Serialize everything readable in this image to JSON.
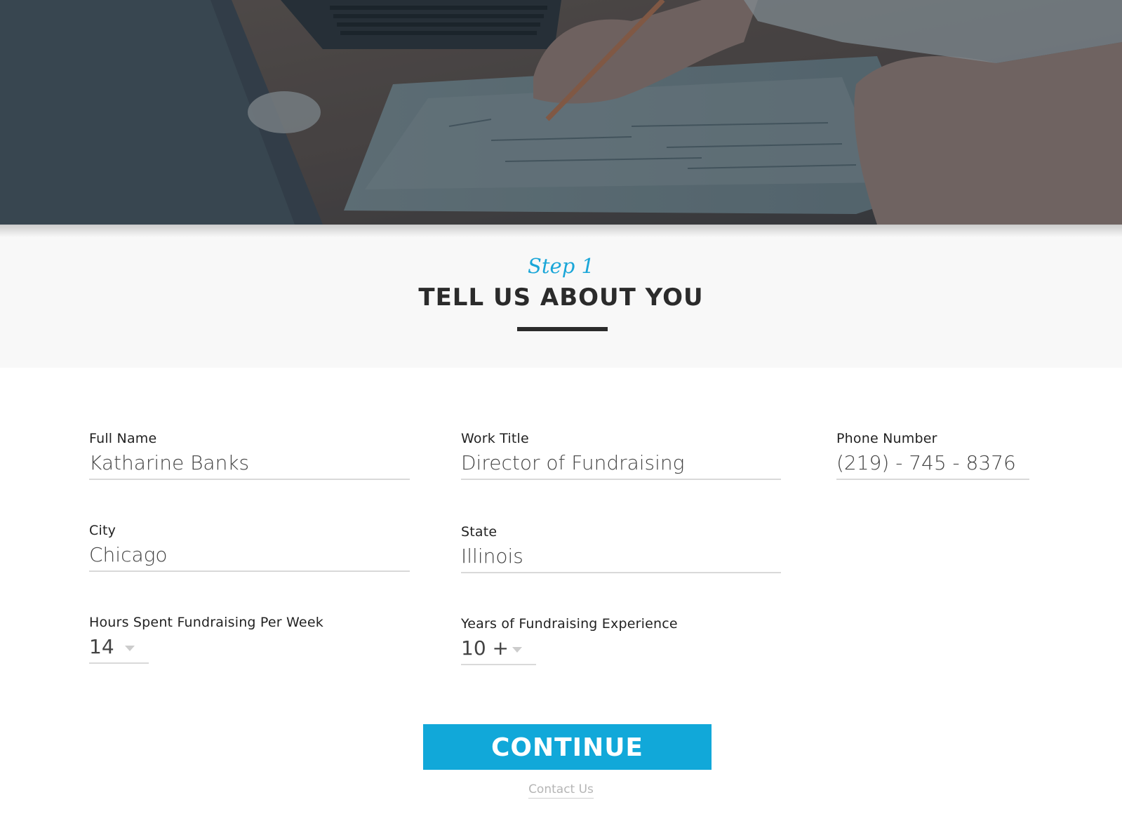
{
  "step": {
    "label": "Step 1",
    "title": "TELL US ABOUT YOU"
  },
  "form": {
    "full_name": {
      "label": "Full Name",
      "value": "Katharine Banks"
    },
    "work_title": {
      "label": "Work Title",
      "value": "Director of Fundraising"
    },
    "phone": {
      "label": "Phone Number",
      "value": "(219) - 745 - 8376"
    },
    "city": {
      "label": "City",
      "value": "Chicago"
    },
    "state": {
      "label": "State",
      "value": "Illinois"
    },
    "hours": {
      "label": "Hours Spent Fundraising Per Week",
      "selected": "14"
    },
    "years": {
      "label": "Years of Fundraising Experience",
      "selected": "10 +"
    }
  },
  "actions": {
    "continue_label": "CONTINUE",
    "contact_label": "Contact Us"
  },
  "colors": {
    "accent": "#11a8d9",
    "heading": "#2b2b2b",
    "header_bg": "#f8f8f8"
  },
  "icons": {
    "dropdown": "caret-down-icon"
  }
}
